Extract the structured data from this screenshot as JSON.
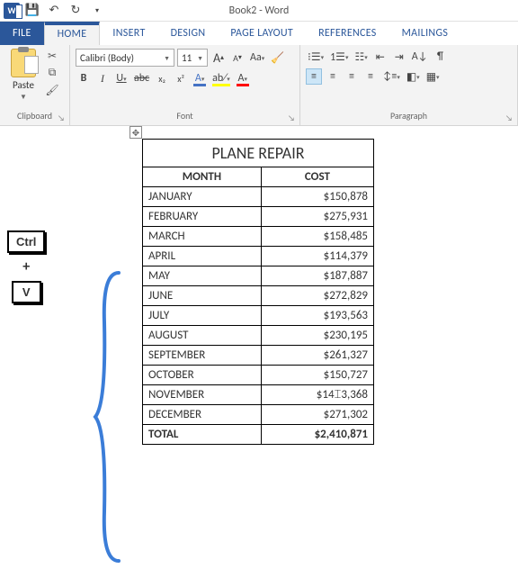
{
  "app": {
    "doc_title": "Book2 - Word"
  },
  "qat": {
    "word": "W",
    "save": "💾",
    "undo": "↶",
    "redo": "↻",
    "custom": "▾"
  },
  "tabs": {
    "file": "FILE",
    "home": "HOME",
    "insert": "INSERT",
    "design": "DESIGN",
    "page_layout": "PAGE LAYOUT",
    "references": "REFERENCES",
    "mailings": "MAILINGS"
  },
  "ribbon": {
    "clipboard": {
      "label": "Clipboard",
      "paste": "Paste",
      "cut": "✂",
      "copy": "⧉",
      "painter": "🖌"
    },
    "font": {
      "label": "Font",
      "name": "Calibri (Body)",
      "size": "11",
      "grow": "A",
      "shrink": "A",
      "case": "Aa",
      "clear": "🧹",
      "bold": "B",
      "italic": "I",
      "underline": "U",
      "strike": "abc",
      "sub": "x₂",
      "sup": "x²",
      "effects": "A",
      "highlight": "ab⁄",
      "color": "A"
    },
    "paragraph": {
      "label": "Paragraph",
      "bullets": "⁝☰",
      "numbers": "1☰",
      "multilevel": "☷",
      "dec_indent": "⇤",
      "inc_indent": "⇥",
      "sort": "A↓",
      "marks": "¶",
      "align_left": "≡",
      "align_center": "≡",
      "align_right": "≡",
      "justify": "≡",
      "spacing": "↕≡",
      "shading": "◧",
      "borders": "▦"
    }
  },
  "kbd": {
    "ctrl": "Ctrl",
    "plus": "+",
    "v": "V"
  },
  "table": {
    "title": "PLANE REPAIR",
    "col_month": "MONTH",
    "col_cost": "COST",
    "rows": [
      {
        "month": "JANUARY",
        "cost": "$150,878"
      },
      {
        "month": "FEBRUARY",
        "cost": "$275,931"
      },
      {
        "month": "MARCH",
        "cost": "$158,485"
      },
      {
        "month": "APRIL",
        "cost": "$114,379"
      },
      {
        "month": "MAY",
        "cost": "$187,887"
      },
      {
        "month": "JUNE",
        "cost": "$272,829"
      },
      {
        "month": "JULY",
        "cost": "$193,563"
      },
      {
        "month": "AUGUST",
        "cost": "$230,195"
      },
      {
        "month": "SEPTEMBER",
        "cost": "$261,327"
      },
      {
        "month": "OCTOBER",
        "cost": "$150,727"
      },
      {
        "month": "NOVEMBER",
        "cost": "$143,368"
      },
      {
        "month": "DECEMBER",
        "cost": "$271,302"
      }
    ],
    "total_label": "TOTAL",
    "total_value": "$2,410,871"
  }
}
